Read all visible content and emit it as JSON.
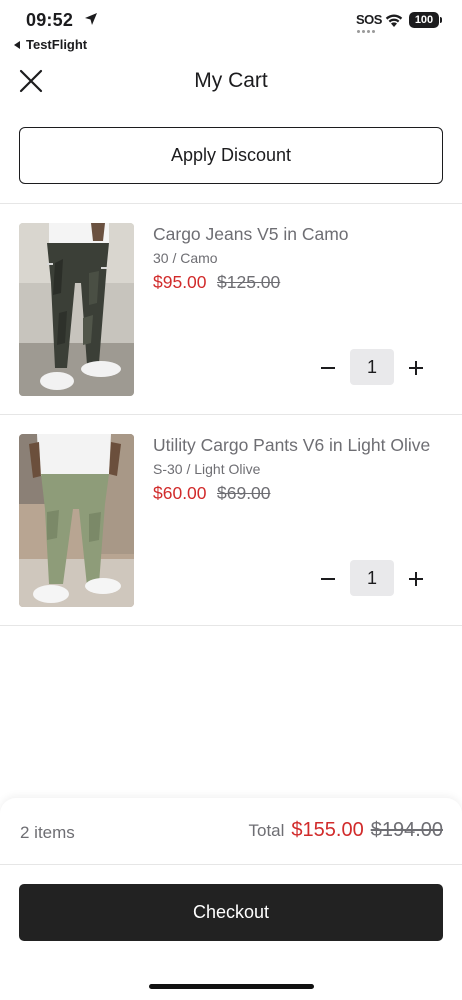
{
  "status_bar": {
    "time": "09:52",
    "back_app": "TestFlight",
    "carrier": "SOS",
    "battery": "100"
  },
  "header": {
    "title": "My Cart",
    "close_icon": "close-icon"
  },
  "discount": {
    "label": "Apply Discount"
  },
  "items": [
    {
      "title": "Cargo Jeans V5 in Camo",
      "variant": "30 / Camo",
      "price": "$95.00",
      "compare_price": "$125.00",
      "quantity": "1",
      "image_colors": {
        "pants": "#3d4238",
        "shirt": "#ffffff",
        "background": "#b7b3ab"
      }
    },
    {
      "title": "Utility Cargo Pants V6 in Light Olive",
      "variant": "S-30 / Light Olive",
      "price": "$60.00",
      "compare_price": "$69.00",
      "quantity": "1",
      "image_colors": {
        "pants": "#8d9b78",
        "shirt": "#ffffff",
        "background": "#b9a894"
      }
    }
  ],
  "summary": {
    "item_count": "2 items",
    "total_label": "Total",
    "total": "$155.00",
    "total_compare": "$194.00",
    "checkout_label": "Checkout"
  },
  "colors": {
    "sale_price": "#d12b2b",
    "muted_text": "#6e6e73",
    "checkout_bg": "#222222",
    "qty_bg": "#e9e9eb"
  }
}
